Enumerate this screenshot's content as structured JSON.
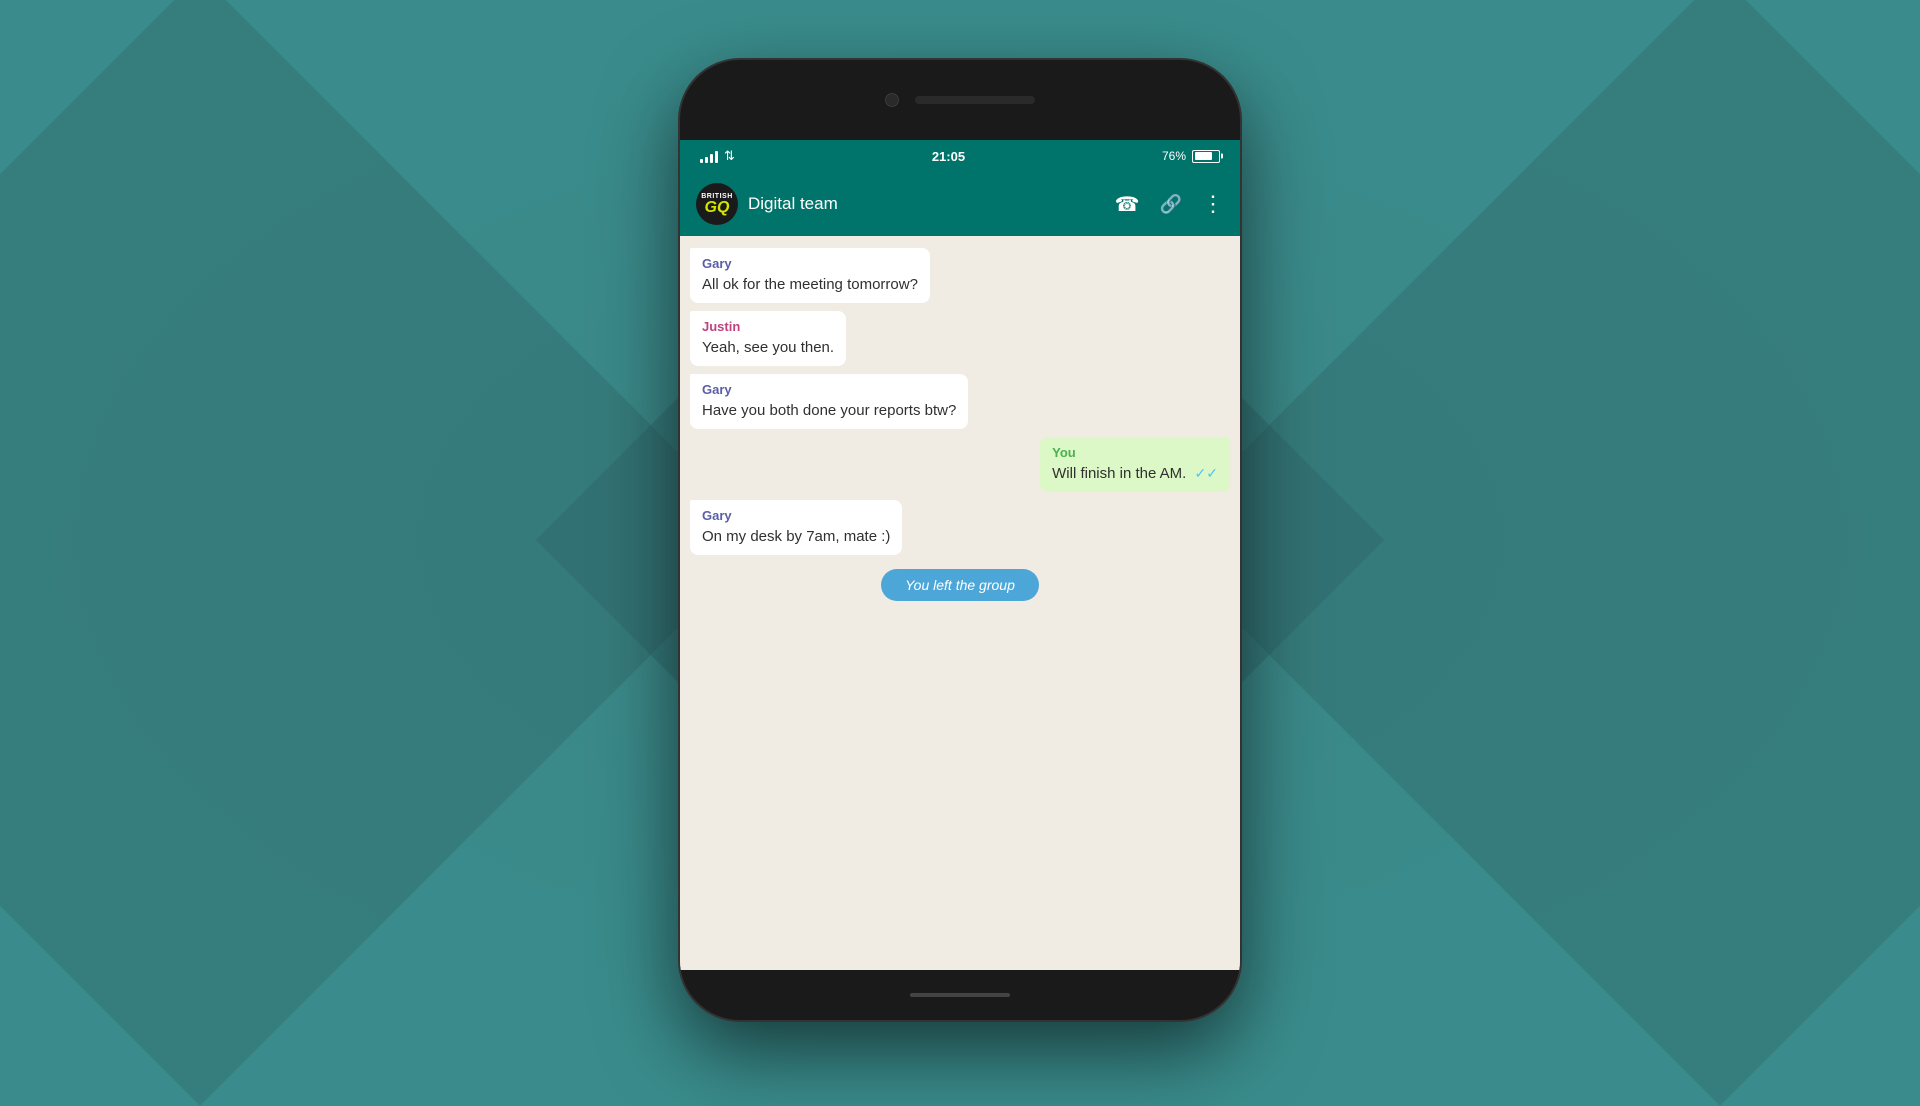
{
  "background": {
    "color": "#3a8c8c"
  },
  "phone": {
    "status_bar": {
      "time": "21:05",
      "battery_percent": "76%"
    },
    "header": {
      "group_name": "Digital team",
      "logo_british": "BRITISH",
      "logo_gq": "GQ"
    },
    "messages": [
      {
        "id": "msg1",
        "direction": "incoming",
        "sender": "Gary",
        "sender_class": "sender-gary",
        "text": "All ok for the meeting tomorrow?"
      },
      {
        "id": "msg2",
        "direction": "incoming",
        "sender": "Justin",
        "sender_class": "sender-justin",
        "text": "Yeah, see you then."
      },
      {
        "id": "msg3",
        "direction": "incoming",
        "sender": "Gary",
        "sender_class": "sender-gary",
        "text": "Have you both done your reports btw?"
      },
      {
        "id": "msg4",
        "direction": "outgoing",
        "sender": "You",
        "sender_class": "sender-you",
        "text": "Will finish in the AM.",
        "ticks": "✓✓"
      },
      {
        "id": "msg5",
        "direction": "incoming",
        "sender": "Gary",
        "sender_class": "sender-gary",
        "text": "On my desk by 7am, mate :)"
      }
    ],
    "system_message": "You left the group"
  }
}
